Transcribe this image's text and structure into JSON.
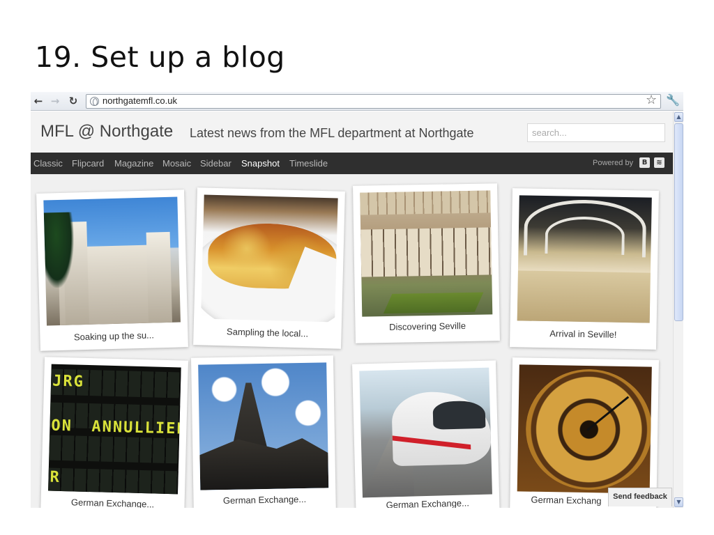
{
  "slide": {
    "title": "19. Set up a blog"
  },
  "browser": {
    "url": "northgatemfl.co.uk",
    "icons": {
      "back": "back-arrow-icon",
      "forward": "forward-arrow-icon",
      "reload": "reload-icon",
      "site": "globe-icon",
      "bookmark": "star-icon",
      "settings": "wrench-icon"
    }
  },
  "blog": {
    "name": "MFL @ Northgate",
    "description": "Latest news from the MFL department at Northgate",
    "search": {
      "placeholder": "search..."
    },
    "views": [
      {
        "label": "Classic",
        "active": false
      },
      {
        "label": "Flipcard",
        "active": false
      },
      {
        "label": "Magazine",
        "active": false
      },
      {
        "label": "Mosaic",
        "active": false
      },
      {
        "label": "Sidebar",
        "active": false
      },
      {
        "label": "Snapshot",
        "active": true
      },
      {
        "label": "Timeslide",
        "active": false
      }
    ],
    "powered_by": "Powered by",
    "powered_icons": [
      "blogger-icon",
      "rss-icon"
    ]
  },
  "posts": [
    {
      "caption": "Soaking up the su..."
    },
    {
      "caption": "Sampling the local..."
    },
    {
      "caption": "Discovering Seville"
    },
    {
      "caption": "Arrival in Seville!"
    },
    {
      "caption": "German Exchange...",
      "board_lines": [
        "JRG",
        "ON",
        "ANNULLIERT",
        "R"
      ]
    },
    {
      "caption": "German Exchange..."
    },
    {
      "caption": "German Exchange..."
    },
    {
      "caption": "German Exchang"
    }
  ],
  "feedback": {
    "label": "Send feedback"
  },
  "colors": {
    "menubar": "#2f2f2f",
    "menu_active": "#ffffff",
    "menu_inactive": "#b8b8b8",
    "page_bg": "#f0f0f0"
  }
}
